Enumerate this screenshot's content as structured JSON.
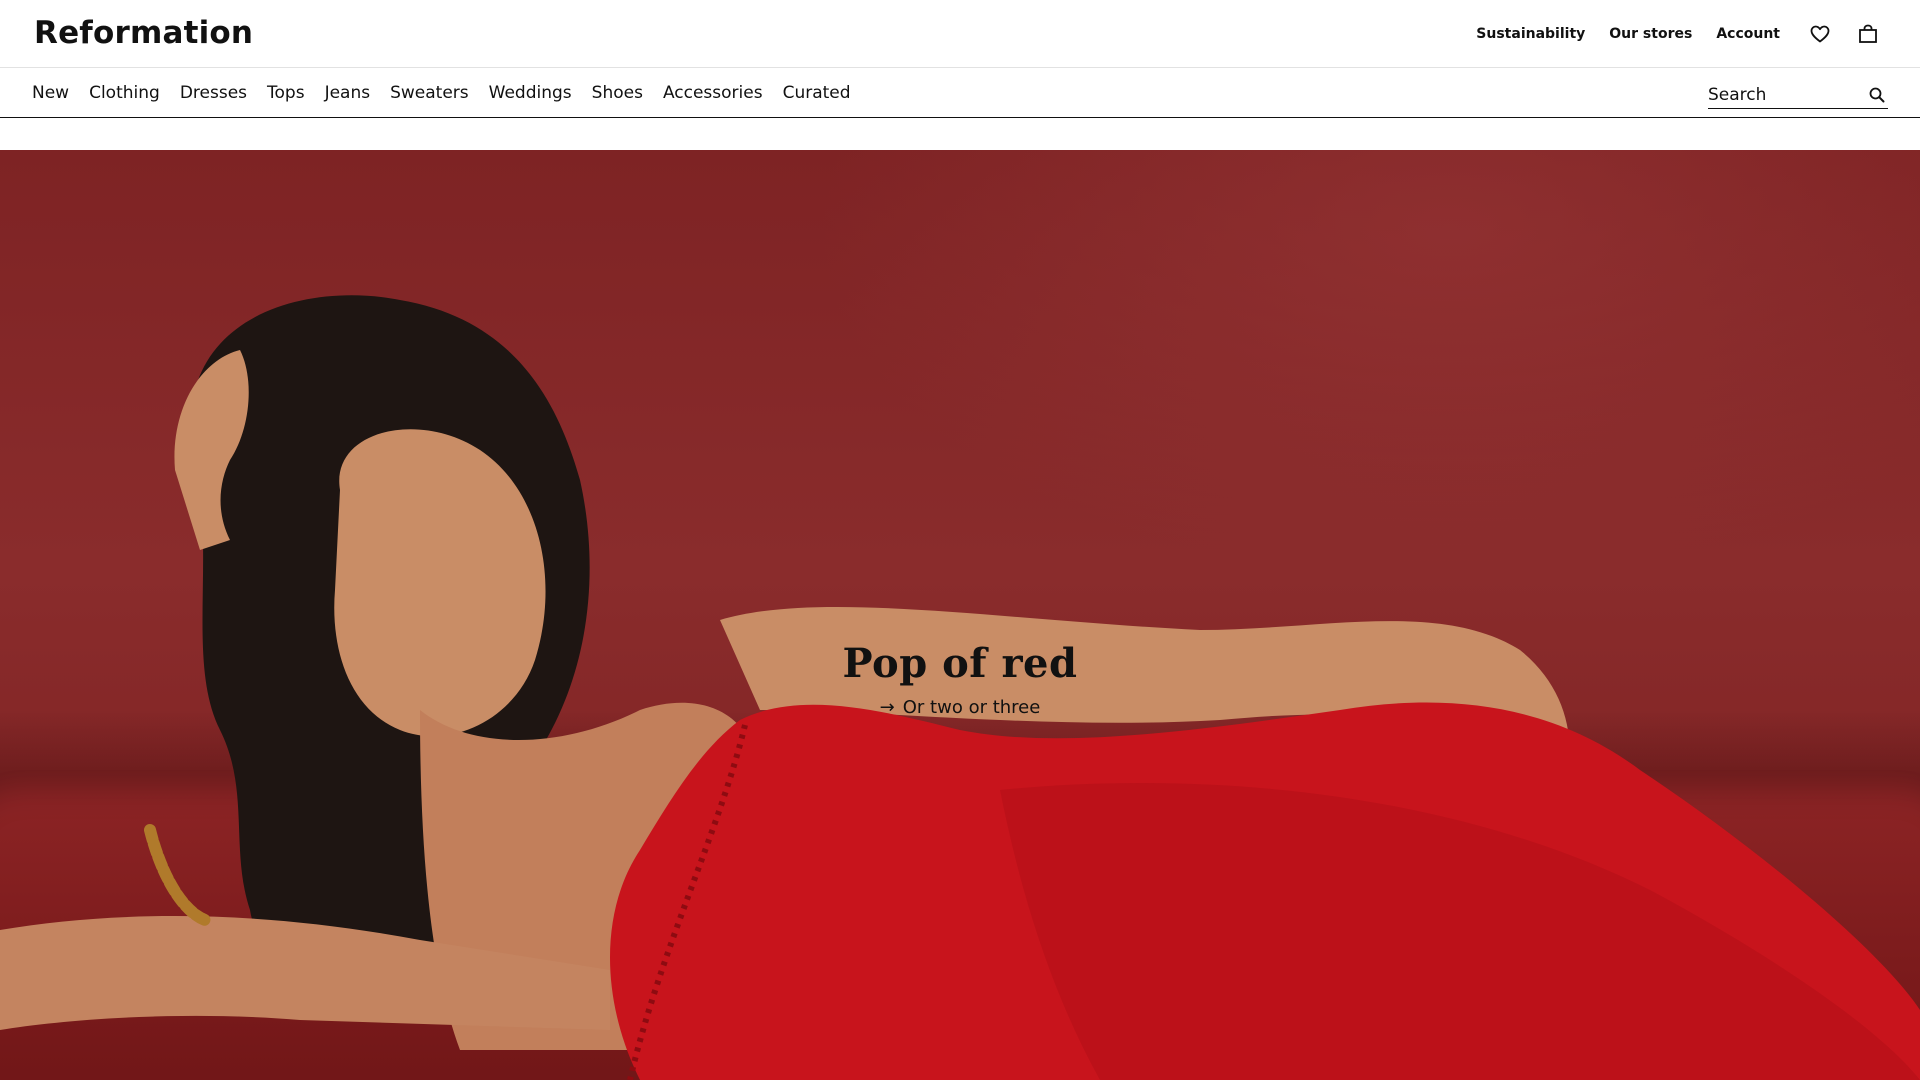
{
  "header": {
    "logo": "Reformation",
    "util_links": [
      {
        "label": "Sustainability"
      },
      {
        "label": "Our stores"
      },
      {
        "label": "Account"
      }
    ],
    "icons": [
      "heart-icon",
      "bag-icon"
    ]
  },
  "nav": {
    "categories": [
      {
        "label": "New"
      },
      {
        "label": "Clothing"
      },
      {
        "label": "Dresses"
      },
      {
        "label": "Tops"
      },
      {
        "label": "Jeans"
      },
      {
        "label": "Sweaters"
      },
      {
        "label": "Weddings"
      },
      {
        "label": "Shoes"
      },
      {
        "label": "Accessories"
      },
      {
        "label": "Curated"
      }
    ],
    "search": {
      "placeholder": "Search",
      "icon": "search-icon"
    }
  },
  "hero": {
    "title": "Pop of red",
    "cta_arrow": "→",
    "cta_label": "Or two or three",
    "colors": {
      "background": "#7c1f20",
      "dress": "#c8141c",
      "skin": "#c98d66",
      "hair": "#1e1512"
    }
  }
}
